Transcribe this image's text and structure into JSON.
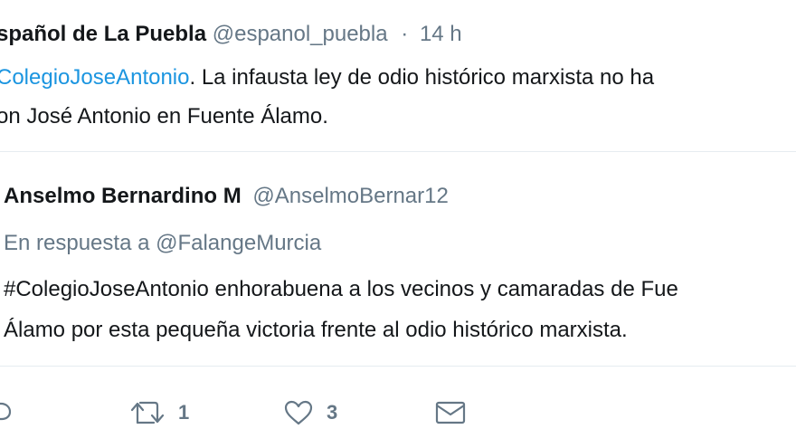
{
  "tweet1": {
    "name": "spañol de La Puebla",
    "handle": "@espanol_puebla",
    "separator": "·",
    "time": "14 h",
    "hashtag": "ColegioJoseAntonio",
    "line1_rest": ". La infausta ley de odio histórico marxista no ha",
    "line2": "on José Antonio en Fuente Álamo."
  },
  "tweet2": {
    "name": "Anselmo Bernardino M",
    "handle": "@AnselmoBernar12",
    "reply_to": "En respuesta a @FalangeMurcia",
    "line1": "#ColegioJoseAntonio enhorabuena a los vecinos y camaradas de Fue",
    "line2": "Álamo por esta pequeña victoria frente al odio histórico marxista."
  },
  "actions": {
    "retweet_count": "1",
    "like_count": "3"
  },
  "icons": {
    "reply": "reply-icon",
    "retweet": "retweet-icon",
    "like": "heart-icon",
    "message": "envelope-icon"
  },
  "colors": {
    "hashtag": "#1b95e0",
    "secondary": "#657786",
    "text": "#14171a"
  }
}
